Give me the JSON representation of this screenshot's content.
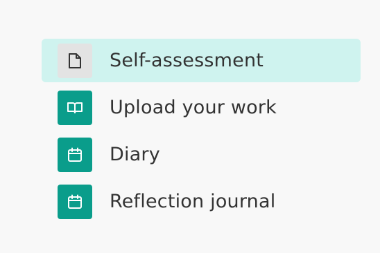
{
  "colors": {
    "active_bg": "#cff3ef",
    "icon_teal": "#0a9d8b",
    "icon_gray": "#e3e3e3",
    "text": "#333333"
  },
  "menu": {
    "items": [
      {
        "label": "Self-assessment",
        "icon": "document-icon",
        "active": true
      },
      {
        "label": "Upload your work",
        "icon": "book-open-icon",
        "active": false
      },
      {
        "label": "Diary",
        "icon": "calendar-icon",
        "active": false
      },
      {
        "label": "Reflection journal",
        "icon": "calendar-icon",
        "active": false
      }
    ]
  }
}
